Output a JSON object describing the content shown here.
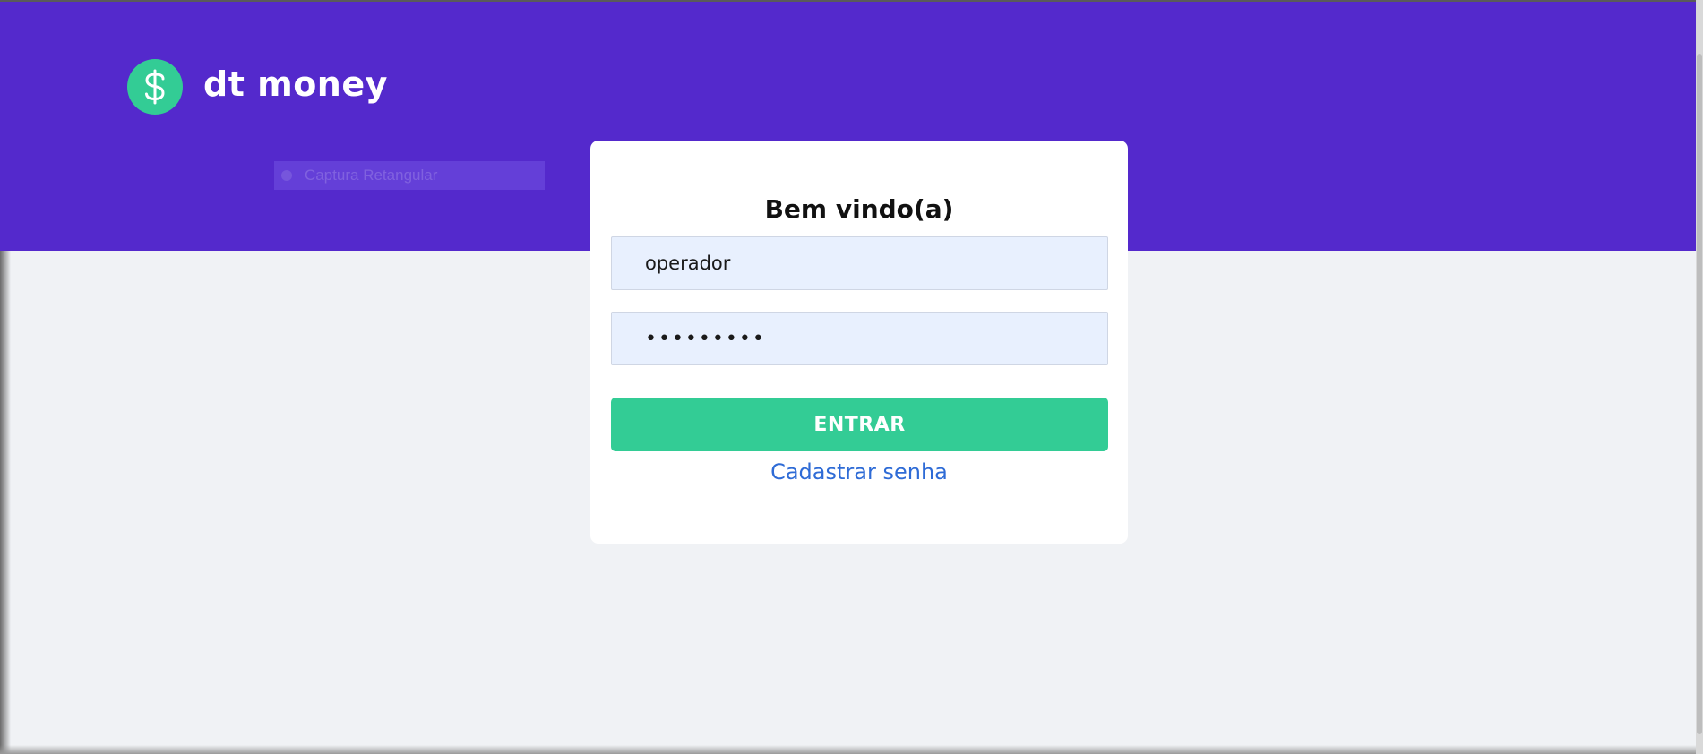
{
  "header": {
    "brand_name": "dt money",
    "logo_icon": "dollar-sign-icon",
    "background_color": "#5429cc"
  },
  "overlay": {
    "capture_label": "Captura Retangular"
  },
  "login": {
    "title": "Bem vindo(a)",
    "username_value": "operador",
    "password_value": "•••••••••",
    "submit_label": "ENTRAR",
    "register_label": "Cadastrar senha"
  },
  "colors": {
    "accent_green": "#33cc95",
    "link_blue": "#2e6bd6",
    "input_bg": "#e8f0fe",
    "page_bg": "#f0f2f5"
  }
}
